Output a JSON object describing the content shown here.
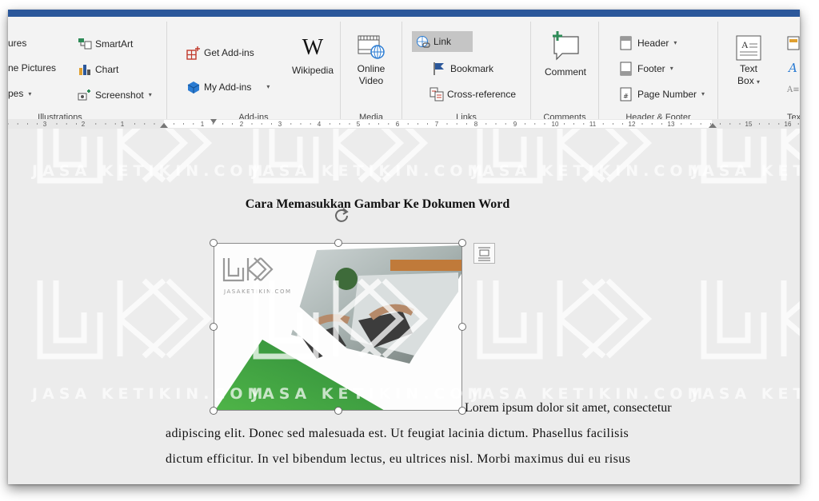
{
  "ribbon": {
    "illustrations": {
      "pictures_partial": "ures",
      "online_pictures_partial": "ne Pictures",
      "shapes_partial": "pes",
      "smartart": "SmartArt",
      "chart": "Chart",
      "screenshot": "Screenshot",
      "group_label": "Illustrations"
    },
    "addins": {
      "get_addins": "Get Add-ins",
      "my_addins": "My Add-ins",
      "wikipedia": "Wikipedia",
      "group_label": "Add-ins"
    },
    "media": {
      "online_video_line1": "Online",
      "online_video_line2": "Video",
      "group_label": "Media"
    },
    "links": {
      "link": "Link",
      "bookmark": "Bookmark",
      "cross_reference": "Cross-reference",
      "group_label": "Links"
    },
    "comments": {
      "comment": "Comment",
      "group_label": "Comments"
    },
    "header_footer": {
      "header": "Header",
      "footer": "Footer",
      "page_number": "Page Number",
      "group_label": "Header & Footer"
    },
    "text": {
      "text_box_line1": "Text",
      "text_box_line2": "Box",
      "group_label_partial": "Tex"
    }
  },
  "ruler": {
    "labels": [
      "3",
      "2",
      "1",
      "1",
      "2",
      "3",
      "4",
      "5",
      "6",
      "7",
      "8",
      "9",
      "10",
      "11",
      "12",
      "13",
      "15",
      "16"
    ]
  },
  "document": {
    "title": "Cara Memasukkan Gambar Ke Dokumen Word",
    "para_line1": "Lorem ipsum dolor sit amet, consectetur",
    "para_line2": "adipiscing elit. Donec sed malesuada est. Ut feugiat lacinia dictum. Phasellus facilisis",
    "para_line3": "dictum efficitur. In vel bibendum lectus, eu ultrices nisl. Morbi maximus dui eu risus"
  },
  "picture": {
    "logo_text": "JASAKETIKIN.COM"
  },
  "watermark": {
    "text": "JASA KETIKIN.COM",
    "logo": "JK"
  },
  "colors": {
    "title_bar": "#2b579a",
    "ribbon_bg": "#f3f3f3",
    "link_highlight": "#c5c5c5",
    "image_green": "#3aa040"
  }
}
